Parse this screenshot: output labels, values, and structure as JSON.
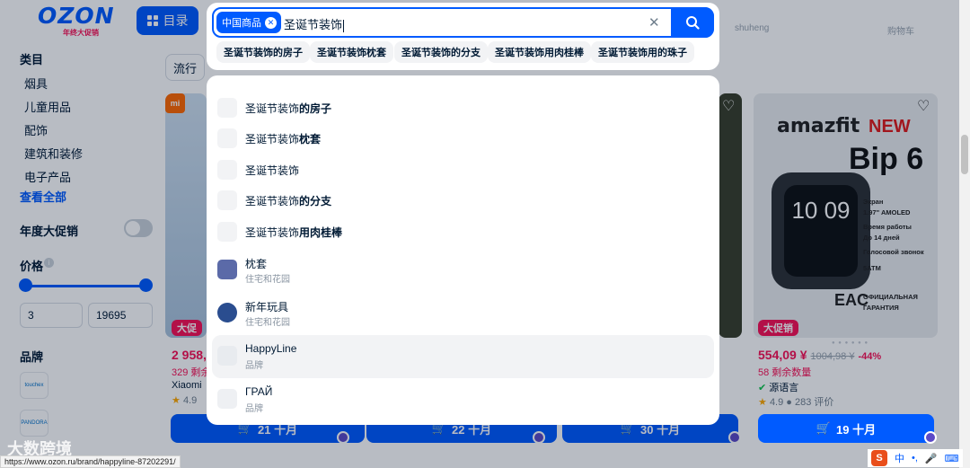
{
  "header": {
    "logo": "OZON",
    "logo_sub": "年终大促销",
    "catalog_label": "目录",
    "links": [
      "shuheng",
      "购物车"
    ]
  },
  "sidebar": {
    "category_title": "类目",
    "categories": [
      "烟具",
      "儿童用品",
      "配饰",
      "建筑和装修",
      "电子产品"
    ],
    "see_all": "查看全部",
    "sale_toggle_label": "年度大促销",
    "price_title": "价格",
    "price_min": "3",
    "price_max": "19695",
    "brand_title": "品牌",
    "brands": [
      "touchex",
      "PANDORA"
    ]
  },
  "main": {
    "filter_chip": "流行",
    "cards": [
      {
        "badge": "大促",
        "price": "2 958,",
        "left": "329 剩余",
        "seller": "Xiaomi",
        "rating": "4.9",
        "buy": "21 十月"
      },
      {
        "buy": "22 十月"
      },
      {
        "buy": "30 十月"
      },
      {
        "brand_word": "amazfit",
        "new_word": "NEW",
        "model": "Bip 6",
        "watch_time": "10 09",
        "specs": [
          "Экран",
          "1.97\" AMOLED",
          "Время работы",
          "До 14 дней",
          "Голосовой звонок",
          "5ATM",
          "ОФИЦИАЛЬНАЯ",
          "ГАРАНТИЯ"
        ],
        "eac": "EAC",
        "badge": "大促销",
        "price": "554,09 ¥",
        "old_price": "1004,98 ¥",
        "discount": "-44%",
        "left": "58 剩余数量",
        "seller": "源语言",
        "rating": "4.9",
        "reviews": "283 评价",
        "buy": "19 十月"
      }
    ]
  },
  "search": {
    "scope_chip": "中国商品",
    "query": "圣诞节装饰",
    "suggestion_chips": [
      "圣诞节装饰的房子",
      "圣诞节装饰枕套",
      "圣诞节装饰的分支",
      "圣诞节装饰用肉桂棒",
      "圣诞节装饰用的珠子"
    ],
    "dropdown": [
      {
        "base": "圣诞节装饰",
        "bold": "的房子"
      },
      {
        "base": "圣诞节装饰",
        "bold": "枕套"
      },
      {
        "base": "圣诞节装饰",
        "bold": ""
      },
      {
        "base": "圣诞节装饰",
        "bold": "的分支"
      },
      {
        "base": "圣诞节装饰",
        "bold": "用肉桂棒"
      }
    ],
    "categories": [
      {
        "name": "枕套",
        "sub": "住宅和花园"
      },
      {
        "name": "新年玩具",
        "sub": "住宅和花园"
      },
      {
        "name": "HappyLine",
        "sub": "品牌"
      },
      {
        "name": "ГРАЙ",
        "sub": "品牌"
      }
    ]
  },
  "status_url": "https://www.ozon.ru/brand/happyline-87202291/",
  "watermark": "大数跨境",
  "ime_label": "中"
}
